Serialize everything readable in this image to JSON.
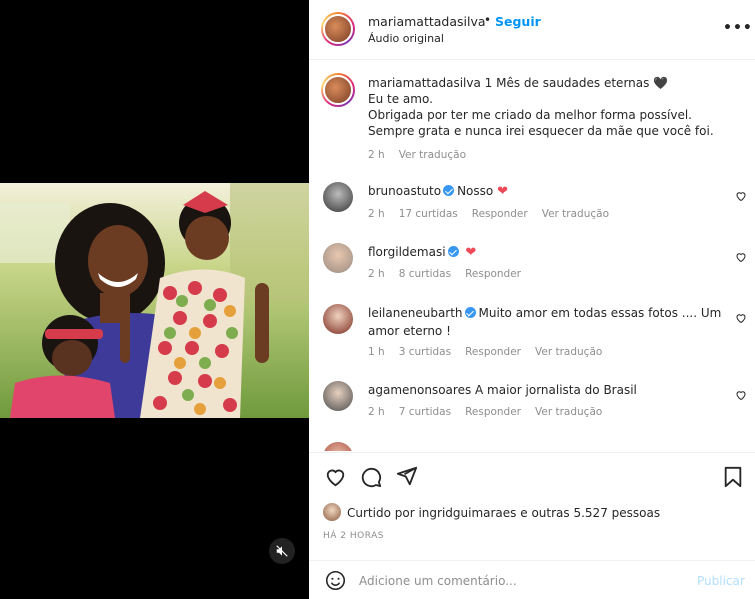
{
  "post": {
    "username": "mariamattadasilva",
    "separator": "•",
    "follow_label": "Seguir",
    "audio_label": "Áudio original",
    "more_label": "•••"
  },
  "caption": {
    "username": "mariamattadasilva",
    "line1": "1 Mês de saudades eternas 🖤",
    "line2": "Eu te amo.",
    "line3": "Obrigada por ter me criado da melhor forma possível.",
    "line4": "Sempre grata e nunca irei esquecer da mãe que você foi.",
    "time": "2 h",
    "translate": "Ver tradução"
  },
  "comments": [
    {
      "username": "brunoastuto",
      "verified": true,
      "text": "Nosso",
      "time": "2 h",
      "likes": "17 curtidas",
      "reply": "Responder",
      "translate": "Ver tradução"
    },
    {
      "username": "florgildemasi",
      "verified": true,
      "text": "",
      "time": "2 h",
      "likes": "8 curtidas",
      "reply": "Responder"
    },
    {
      "username": "leilaneneubarth",
      "verified": true,
      "text": "Muito amor em todas essas fotos .... Um",
      "text2": "amor eterno !",
      "time": "1 h",
      "likes": "3 curtidas",
      "reply": "Responder",
      "translate": "Ver tradução"
    },
    {
      "username": "agamenonsoares",
      "verified": false,
      "text": "A maior jornalista do Brasil",
      "time": "2 h",
      "likes": "7 curtidas",
      "reply": "Responder",
      "translate": "Ver tradução"
    }
  ],
  "likes": {
    "prefix": "Curtido por",
    "user": "ingridguimaraes",
    "connector": "e",
    "others": "outras 5.527 pessoas"
  },
  "time_ago": "HÁ 2 HORAS",
  "add_comment": {
    "placeholder": "Adicione um comentário...",
    "publish_label": "Publicar"
  },
  "colors": {
    "accent": "#0095f6",
    "heart": "#ed4956",
    "muted": "#8e8e8e",
    "verified": "#3897f0"
  }
}
